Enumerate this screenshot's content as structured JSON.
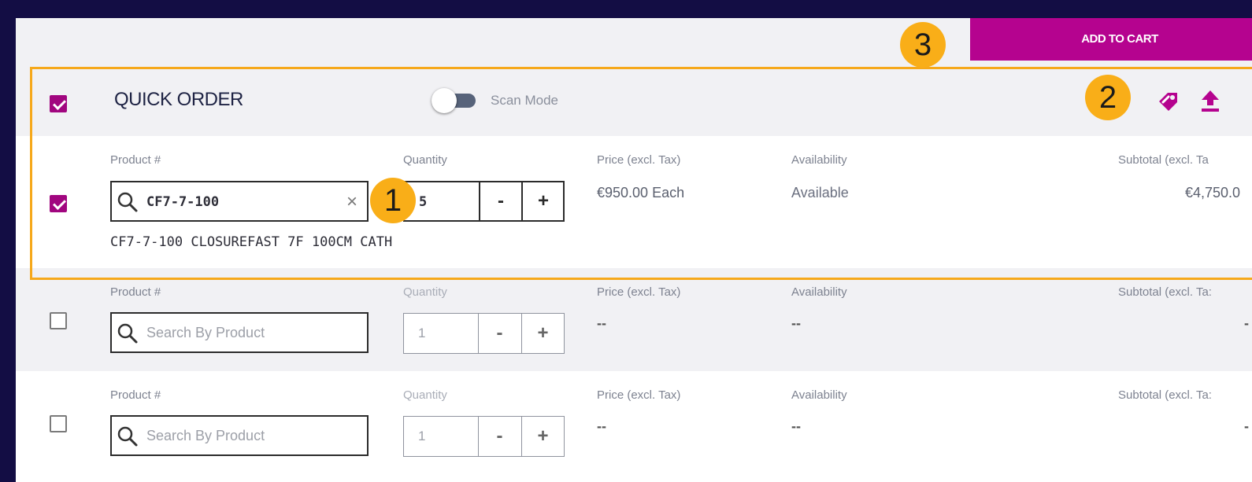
{
  "toolbar": {
    "add_to_cart_label": "ADD TO CART"
  },
  "badges": [
    "1",
    "2",
    "3"
  ],
  "quick_order": {
    "title": "QUICK ORDER",
    "scan_mode_label": "Scan Mode",
    "scan_mode_on": false,
    "select_all_checked": true
  },
  "columns": {
    "product": "Product #",
    "quantity": "Quantity",
    "price": "Price (excl. Tax)",
    "availability": "Availability",
    "subtotal": "Subtotal (excl. Ta"
  },
  "rows": [
    {
      "checked": true,
      "product_value": "CF7-7-100",
      "quantity": "5",
      "price": "€950.00 Each",
      "availability": "Available",
      "subtotal": "€4,750.0",
      "description": "CF7-7-100 CLOSUREFAST 7F 100CM CATH"
    },
    {
      "checked": false,
      "search_placeholder": "Search By Product",
      "quantity": "1",
      "price": "--",
      "availability": "--",
      "subtotal": "-",
      "subtotal_label": "Subtotal (excl. Ta:"
    },
    {
      "checked": false,
      "search_placeholder": "Search By Product",
      "quantity": "1",
      "price": "--",
      "availability": "--",
      "subtotal": "-",
      "subtotal_label": "Subtotal (excl. Ta:"
    }
  ],
  "stepper": {
    "minus": "-",
    "plus": "+",
    "clear": "×"
  },
  "icons": [
    "search-icon",
    "tag-icon",
    "upload-icon",
    "close-icon"
  ],
  "colors": {
    "brand": "#b5038f",
    "highlight": "#f6a81a",
    "badge": "#f9ae18",
    "background": "#130d44"
  }
}
